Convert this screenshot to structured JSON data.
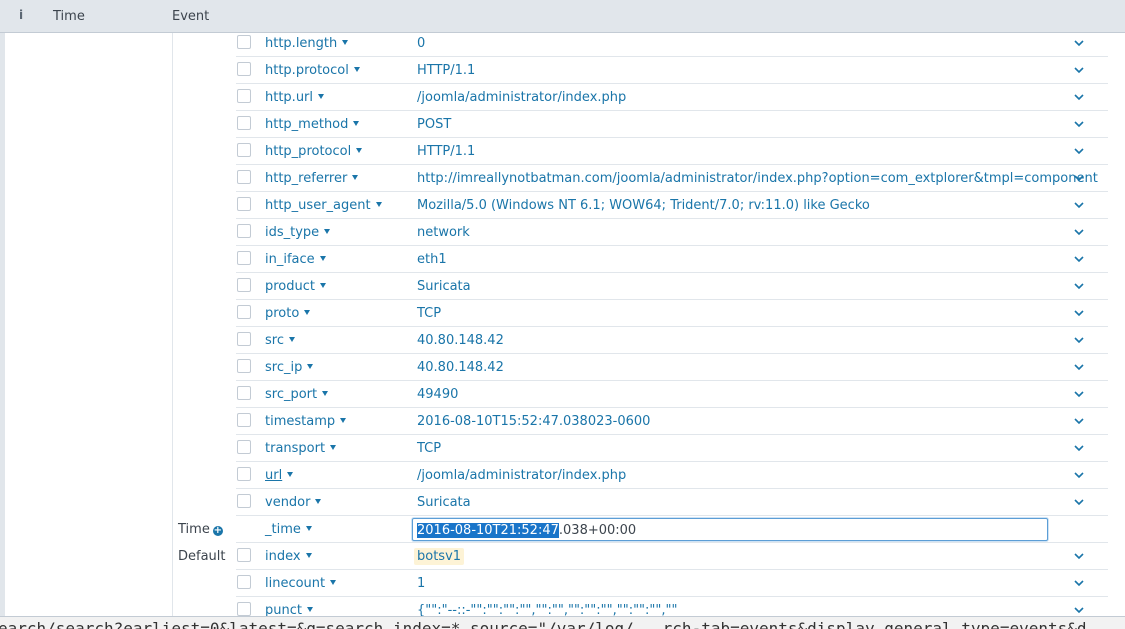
{
  "header": {
    "info_icon": "i",
    "time_label": "Time",
    "event_label": "Event"
  },
  "colors": {
    "link": "#1a75a9",
    "header_bg": "#e1e6eb",
    "highlight": "#fdf3d6",
    "selection": "#1a75c9"
  },
  "fields": [
    {
      "name": "http.length",
      "value": "0"
    },
    {
      "name": "http.protocol",
      "value": "HTTP/1.1"
    },
    {
      "name": "http.url",
      "value": "/joomla/administrator/index.php"
    },
    {
      "name": "http_method",
      "value": "POST"
    },
    {
      "name": "http_protocol",
      "value": "HTTP/1.1"
    },
    {
      "name": "http_referrer",
      "value": "http://imreallynotbatman.com/joomla/administrator/index.php?option=com_extplorer&tmpl=component"
    },
    {
      "name": "http_user_agent",
      "value": "Mozilla/5.0 (Windows NT 6.1; WOW64; Trident/7.0; rv:11.0) like Gecko"
    },
    {
      "name": "ids_type",
      "value": "network"
    },
    {
      "name": "in_iface",
      "value": "eth1"
    },
    {
      "name": "product",
      "value": "Suricata"
    },
    {
      "name": "proto",
      "value": "TCP"
    },
    {
      "name": "src",
      "value": "40.80.148.42"
    },
    {
      "name": "src_ip",
      "value": "40.80.148.42"
    },
    {
      "name": "src_port",
      "value": "49490"
    },
    {
      "name": "timestamp",
      "value": "2016-08-10T15:52:47.038023-0600"
    },
    {
      "name": "transport",
      "value": "TCP"
    },
    {
      "name": "url",
      "value": "/joomla/administrator/index.php"
    },
    {
      "name": "vendor",
      "value": "Suricata"
    }
  ],
  "time_section": {
    "label": "Time",
    "field": "_time",
    "value_selected": "2016-08-10T21:52:47",
    "value_rest": ".038+00:00"
  },
  "default_section": {
    "label": "Default",
    "fields": [
      {
        "name": "index",
        "value": "botsv1"
      },
      {
        "name": "linecount",
        "value": "1"
      },
      {
        "name": "punct",
        "value": "{\"\":\"--::-\"\":\"\":\"\":\"\",\"\":\"\",\"\":\"\":\"\",\"\":\"\":\"\",\"\""
      }
    ]
  },
  "status_url": "earch/search?earliest=0&latest=&q=search index=* source=\"/var/log/...rch-tab=events&display.general.type=events&d"
}
